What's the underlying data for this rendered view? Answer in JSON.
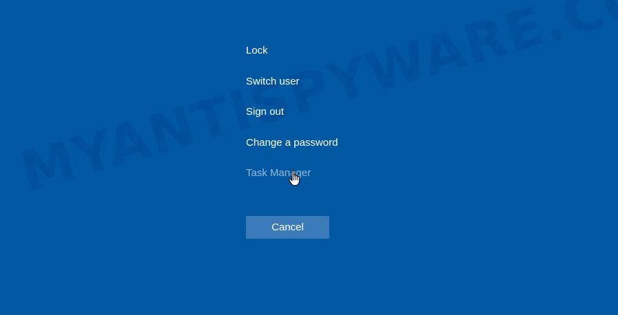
{
  "menu": {
    "items": [
      {
        "label": "Lock"
      },
      {
        "label": "Switch user"
      },
      {
        "label": "Sign out"
      },
      {
        "label": "Change a password"
      },
      {
        "label": "Task Manager",
        "state": "hovered"
      }
    ]
  },
  "cancel": {
    "label": "Cancel"
  },
  "watermark": {
    "text": "MYANTISPYWARE.COM"
  },
  "cursor": {
    "type": "hand-pointer"
  },
  "colors": {
    "background": "#0058a3",
    "text": "#ffffff",
    "hover_text": "#97b9dc",
    "button": "#3b7ab8"
  }
}
